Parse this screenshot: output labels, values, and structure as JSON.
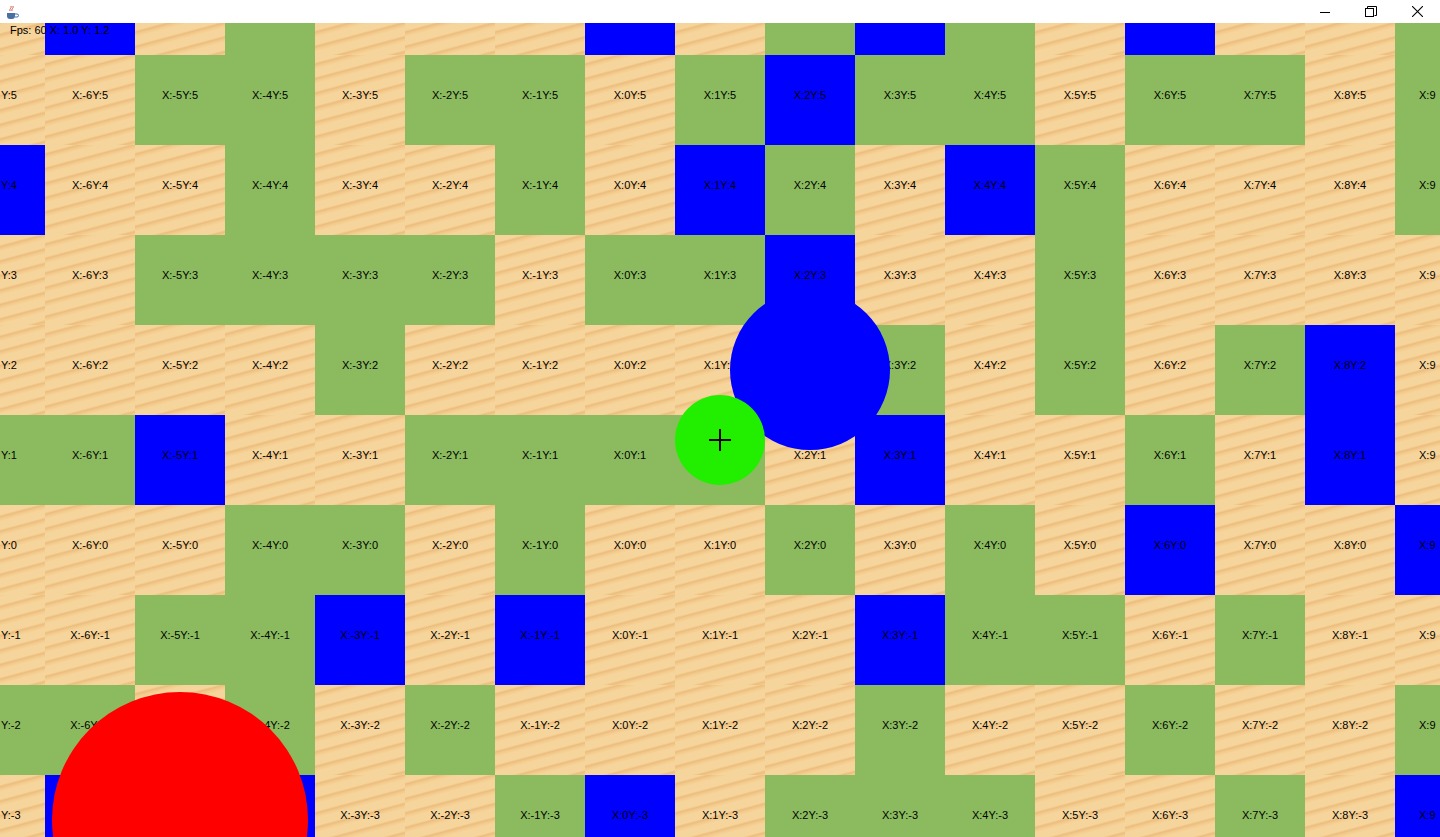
{
  "hud": {
    "text": "Fps: 60 X: 1.0 Y: 1.2"
  },
  "rows": [
    {
      "tiles": [
        {
          "label": "",
          "kind": "sand"
        },
        {
          "label": "",
          "kind": "water"
        },
        {
          "label": "",
          "kind": "sand"
        },
        {
          "label": "",
          "kind": "grass"
        },
        {
          "label": "",
          "kind": "sand"
        },
        {
          "label": "",
          "kind": "sand"
        },
        {
          "label": "",
          "kind": "sand"
        },
        {
          "label": "",
          "kind": "water"
        },
        {
          "label": "",
          "kind": "sand"
        },
        {
          "label": "",
          "kind": "grass"
        },
        {
          "label": "",
          "kind": "water"
        },
        {
          "label": "",
          "kind": "grass"
        },
        {
          "label": "",
          "kind": "sand"
        },
        {
          "label": "",
          "kind": "water"
        },
        {
          "label": "",
          "kind": "sand"
        },
        {
          "label": "",
          "kind": "sand"
        },
        {
          "label": "",
          "kind": "grass"
        }
      ]
    },
    {
      "tiles": [
        {
          "label": "Y:5",
          "kind": "sand"
        },
        {
          "label": "X:-6Y:5",
          "kind": "sand"
        },
        {
          "label": "X:-5Y:5",
          "kind": "grass"
        },
        {
          "label": "X:-4Y:5",
          "kind": "grass"
        },
        {
          "label": "X:-3Y:5",
          "kind": "sand"
        },
        {
          "label": "X:-2Y:5",
          "kind": "grass"
        },
        {
          "label": "X:-1Y:5",
          "kind": "grass"
        },
        {
          "label": "X:0Y:5",
          "kind": "sand"
        },
        {
          "label": "X:1Y:5",
          "kind": "grass"
        },
        {
          "label": "X:2Y:5",
          "kind": "water"
        },
        {
          "label": "X:3Y:5",
          "kind": "grass"
        },
        {
          "label": "X:4Y:5",
          "kind": "grass"
        },
        {
          "label": "X:5Y:5",
          "kind": "sand"
        },
        {
          "label": "X:6Y:5",
          "kind": "grass"
        },
        {
          "label": "X:7Y:5",
          "kind": "grass"
        },
        {
          "label": "X:8Y:5",
          "kind": "sand"
        },
        {
          "label": "X:9",
          "kind": "grass"
        }
      ]
    },
    {
      "tiles": [
        {
          "label": "Y:4",
          "kind": "water"
        },
        {
          "label": "X:-6Y:4",
          "kind": "sand"
        },
        {
          "label": "X:-5Y:4",
          "kind": "sand"
        },
        {
          "label": "X:-4Y:4",
          "kind": "grass"
        },
        {
          "label": "X:-3Y:4",
          "kind": "sand"
        },
        {
          "label": "X:-2Y:4",
          "kind": "sand"
        },
        {
          "label": "X:-1Y:4",
          "kind": "grass"
        },
        {
          "label": "X:0Y:4",
          "kind": "sand"
        },
        {
          "label": "X:1Y:4",
          "kind": "water"
        },
        {
          "label": "X:2Y:4",
          "kind": "grass"
        },
        {
          "label": "X:3Y:4",
          "kind": "sand"
        },
        {
          "label": "X:4Y:4",
          "kind": "water"
        },
        {
          "label": "X:5Y:4",
          "kind": "grass"
        },
        {
          "label": "X:6Y:4",
          "kind": "sand"
        },
        {
          "label": "X:7Y:4",
          "kind": "sand"
        },
        {
          "label": "X:8Y:4",
          "kind": "sand"
        },
        {
          "label": "X:9",
          "kind": "grass"
        }
      ]
    },
    {
      "tiles": [
        {
          "label": "Y:3",
          "kind": "sand"
        },
        {
          "label": "X:-6Y:3",
          "kind": "sand"
        },
        {
          "label": "X:-5Y:3",
          "kind": "grass"
        },
        {
          "label": "X:-4Y:3",
          "kind": "grass"
        },
        {
          "label": "X:-3Y:3",
          "kind": "grass"
        },
        {
          "label": "X:-2Y:3",
          "kind": "grass"
        },
        {
          "label": "X:-1Y:3",
          "kind": "sand"
        },
        {
          "label": "X:0Y:3",
          "kind": "grass"
        },
        {
          "label": "X:1Y:3",
          "kind": "grass"
        },
        {
          "label": "X:2Y:3",
          "kind": "water"
        },
        {
          "label": "X:3Y:3",
          "kind": "sand"
        },
        {
          "label": "X:4Y:3",
          "kind": "sand"
        },
        {
          "label": "X:5Y:3",
          "kind": "grass"
        },
        {
          "label": "X:6Y:3",
          "kind": "sand"
        },
        {
          "label": "X:7Y:3",
          "kind": "sand"
        },
        {
          "label": "X:8Y:3",
          "kind": "sand"
        },
        {
          "label": "X:9",
          "kind": "sand"
        }
      ]
    },
    {
      "tiles": [
        {
          "label": "Y:2",
          "kind": "sand"
        },
        {
          "label": "X:-6Y:2",
          "kind": "sand"
        },
        {
          "label": "X:-5Y:2",
          "kind": "sand"
        },
        {
          "label": "X:-4Y:2",
          "kind": "sand"
        },
        {
          "label": "X:-3Y:2",
          "kind": "grass"
        },
        {
          "label": "X:-2Y:2",
          "kind": "sand"
        },
        {
          "label": "X:-1Y:2",
          "kind": "sand"
        },
        {
          "label": "X:0Y:2",
          "kind": "sand"
        },
        {
          "label": "X:1Y:2",
          "kind": "sand"
        },
        {
          "label": "",
          "kind": "grass"
        },
        {
          "label": "X:3Y:2",
          "kind": "grass"
        },
        {
          "label": "X:4Y:2",
          "kind": "sand"
        },
        {
          "label": "X:5Y:2",
          "kind": "grass"
        },
        {
          "label": "X:6Y:2",
          "kind": "sand"
        },
        {
          "label": "X:7Y:2",
          "kind": "grass"
        },
        {
          "label": "X:8Y:2",
          "kind": "water"
        },
        {
          "label": "X:9",
          "kind": "sand"
        }
      ]
    },
    {
      "tiles": [
        {
          "label": "Y:1",
          "kind": "grass"
        },
        {
          "label": "X:-6Y:1",
          "kind": "grass"
        },
        {
          "label": "X:-5Y:1",
          "kind": "water"
        },
        {
          "label": "X:-4Y:1",
          "kind": "sand"
        },
        {
          "label": "X:-3Y:1",
          "kind": "sand"
        },
        {
          "label": "X:-2Y:1",
          "kind": "grass"
        },
        {
          "label": "X:-1Y:1",
          "kind": "grass"
        },
        {
          "label": "X:0Y:1",
          "kind": "grass"
        },
        {
          "label": "",
          "kind": "grass"
        },
        {
          "label": "X:2Y:1",
          "kind": "sand"
        },
        {
          "label": "X:3Y:1",
          "kind": "water"
        },
        {
          "label": "X:4Y:1",
          "kind": "sand"
        },
        {
          "label": "X:5Y:1",
          "kind": "sand"
        },
        {
          "label": "X:6Y:1",
          "kind": "grass"
        },
        {
          "label": "X:7Y:1",
          "kind": "sand"
        },
        {
          "label": "X:8Y:1",
          "kind": "water"
        },
        {
          "label": "X:9",
          "kind": "sand"
        }
      ]
    },
    {
      "tiles": [
        {
          "label": "Y:0",
          "kind": "sand"
        },
        {
          "label": "X:-6Y:0",
          "kind": "sand"
        },
        {
          "label": "X:-5Y:0",
          "kind": "sand"
        },
        {
          "label": "X:-4Y:0",
          "kind": "grass"
        },
        {
          "label": "X:-3Y:0",
          "kind": "grass"
        },
        {
          "label": "X:-2Y:0",
          "kind": "sand"
        },
        {
          "label": "X:-1Y:0",
          "kind": "grass"
        },
        {
          "label": "X:0Y:0",
          "kind": "sand"
        },
        {
          "label": "X:1Y:0",
          "kind": "sand"
        },
        {
          "label": "X:2Y:0",
          "kind": "grass"
        },
        {
          "label": "X:3Y:0",
          "kind": "sand"
        },
        {
          "label": "X:4Y:0",
          "kind": "grass"
        },
        {
          "label": "X:5Y:0",
          "kind": "sand"
        },
        {
          "label": "X:6Y:0",
          "kind": "water"
        },
        {
          "label": "X:7Y:0",
          "kind": "sand"
        },
        {
          "label": "X:8Y:0",
          "kind": "sand"
        },
        {
          "label": "X:9",
          "kind": "water"
        }
      ]
    },
    {
      "tiles": [
        {
          "label": "Y:-1",
          "kind": "sand"
        },
        {
          "label": "X:-6Y:-1",
          "kind": "sand"
        },
        {
          "label": "X:-5Y:-1",
          "kind": "grass"
        },
        {
          "label": "X:-4Y:-1",
          "kind": "grass"
        },
        {
          "label": "X:-3Y:-1",
          "kind": "water"
        },
        {
          "label": "X:-2Y:-1",
          "kind": "sand"
        },
        {
          "label": "X:-1Y:-1",
          "kind": "water"
        },
        {
          "label": "X:0Y:-1",
          "kind": "sand"
        },
        {
          "label": "X:1Y:-1",
          "kind": "sand"
        },
        {
          "label": "X:2Y:-1",
          "kind": "sand"
        },
        {
          "label": "X:3Y:-1",
          "kind": "water"
        },
        {
          "label": "X:4Y:-1",
          "kind": "grass"
        },
        {
          "label": "X:5Y:-1",
          "kind": "grass"
        },
        {
          "label": "X:6Y:-1",
          "kind": "sand"
        },
        {
          "label": "X:7Y:-1",
          "kind": "grass"
        },
        {
          "label": "X:8Y:-1",
          "kind": "sand"
        },
        {
          "label": "X:9",
          "kind": "sand"
        }
      ]
    },
    {
      "tiles": [
        {
          "label": "Y:-2",
          "kind": "grass"
        },
        {
          "label": "X:-6Y:-2",
          "kind": "grass"
        },
        {
          "label": "",
          "kind": "sand"
        },
        {
          "label": "X:-4Y:-2",
          "kind": "grass"
        },
        {
          "label": "X:-3Y:-2",
          "kind": "sand"
        },
        {
          "label": "X:-2Y:-2",
          "kind": "grass"
        },
        {
          "label": "X:-1Y:-2",
          "kind": "sand"
        },
        {
          "label": "X:0Y:-2",
          "kind": "sand"
        },
        {
          "label": "X:1Y:-2",
          "kind": "sand"
        },
        {
          "label": "X:2Y:-2",
          "kind": "sand"
        },
        {
          "label": "X:3Y:-2",
          "kind": "grass"
        },
        {
          "label": "X:4Y:-2",
          "kind": "sand"
        },
        {
          "label": "X:5Y:-2",
          "kind": "sand"
        },
        {
          "label": "X:6Y:-2",
          "kind": "grass"
        },
        {
          "label": "X:7Y:-2",
          "kind": "sand"
        },
        {
          "label": "X:8Y:-2",
          "kind": "sand"
        },
        {
          "label": "X:9",
          "kind": "grass"
        }
      ]
    },
    {
      "tiles": [
        {
          "label": "Y:-3",
          "kind": "sand"
        },
        {
          "label": "",
          "kind": "water"
        },
        {
          "label": "",
          "kind": "sand"
        },
        {
          "label": "",
          "kind": "water"
        },
        {
          "label": "X:-3Y:-3",
          "kind": "sand"
        },
        {
          "label": "X:-2Y:-3",
          "kind": "sand"
        },
        {
          "label": "X:-1Y:-3",
          "kind": "grass"
        },
        {
          "label": "X:0Y:-3",
          "kind": "water"
        },
        {
          "label": "X:1Y:-3",
          "kind": "sand"
        },
        {
          "label": "X:2Y:-3",
          "kind": "grass"
        },
        {
          "label": "X:3Y:-3",
          "kind": "grass"
        },
        {
          "label": "X:4Y:-3",
          "kind": "grass"
        },
        {
          "label": "X:5Y:-3",
          "kind": "sand"
        },
        {
          "label": "X:6Y:-3",
          "kind": "sand"
        },
        {
          "label": "X:7Y:-3",
          "kind": "grass"
        },
        {
          "label": "X:8Y:-3",
          "kind": "sand"
        },
        {
          "label": "X:9",
          "kind": "water"
        }
      ]
    }
  ],
  "entities": [
    {
      "kind": "blob",
      "color": "#0000ff"
    },
    {
      "kind": "player",
      "color": "#22ee00"
    },
    {
      "kind": "enemy",
      "color": "#ff0000"
    }
  ]
}
